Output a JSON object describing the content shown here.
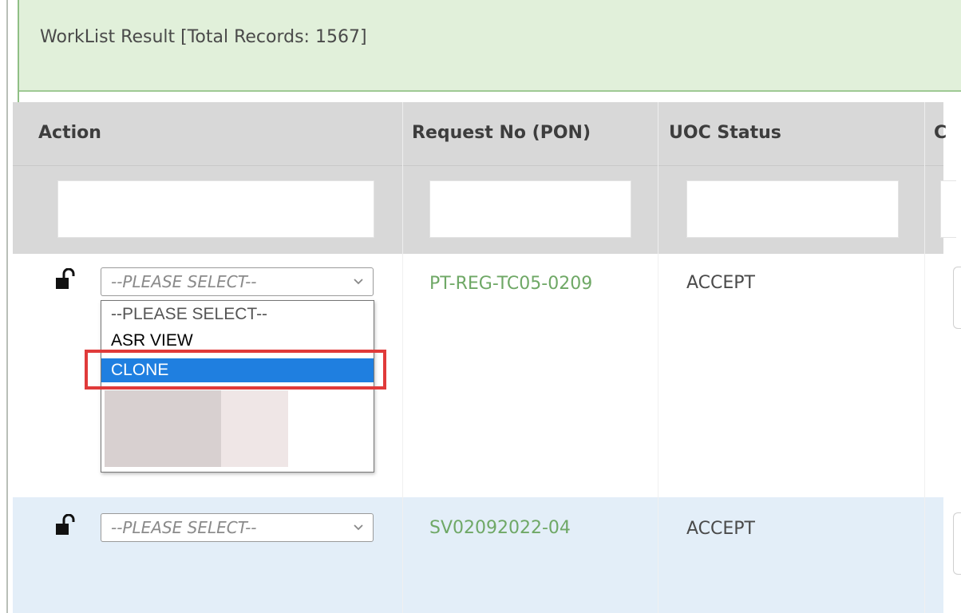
{
  "panel": {
    "title": "WorkList Result [Total Records: 1567]"
  },
  "table": {
    "columns": [
      "Action",
      "Request No (PON)",
      "UOC Status",
      "C"
    ],
    "rows": [
      {
        "action_select": "--PLEASE SELECT--",
        "request_no": "PT-REG-TC05-0209",
        "uoc_status": "ACCEPT"
      },
      {
        "action_select": "--PLEASE SELECT--",
        "request_no": "SV02092022-04",
        "uoc_status": "ACCEPT"
      }
    ]
  },
  "dropdown": {
    "options": [
      "--PLEASE SELECT--",
      "ASR VIEW",
      "CLONE"
    ],
    "highlighted": "CLONE"
  },
  "colors": {
    "header_bg": "#e1f0da",
    "link": "#6fa866",
    "selected_option": "#1f7fe0",
    "highlight_box": "#e03a3a",
    "row_alt": "#e3eef8"
  }
}
